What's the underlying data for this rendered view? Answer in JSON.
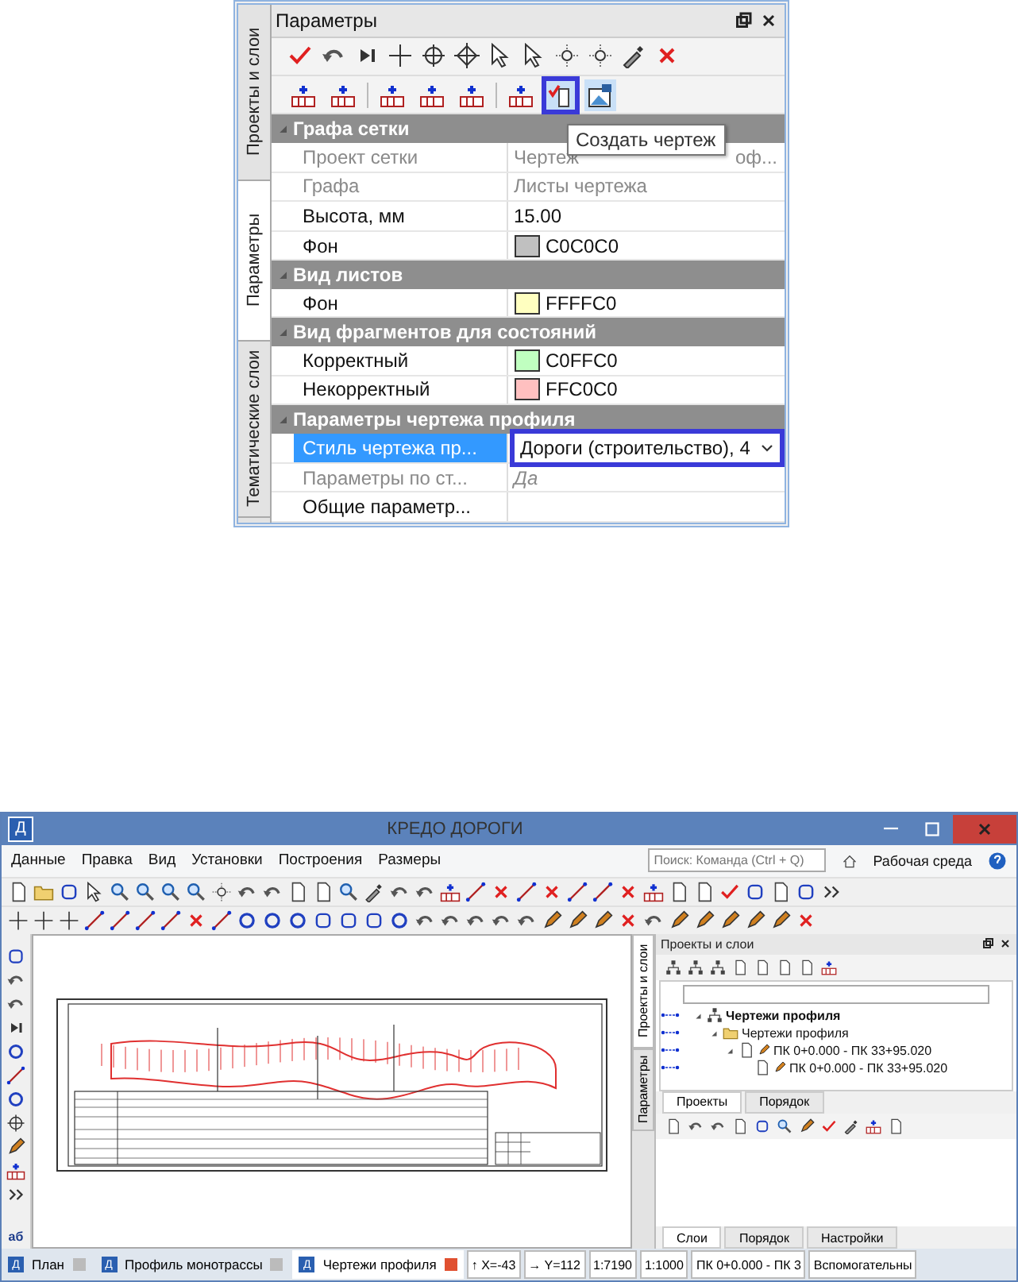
{
  "params_panel": {
    "side_tabs": [
      {
        "label": "Проекты и слои",
        "selected": false
      },
      {
        "label": "Параметры",
        "selected": true
      },
      {
        "label": "Тематические слои",
        "selected": false
      }
    ],
    "title": "Параметры",
    "toolbar_2": [
      {
        "pressed": false,
        "highlighted": false
      },
      {
        "pressed": false,
        "highlighted": false
      },
      {
        "pressed": false,
        "highlighted": false
      },
      {
        "pressed": false,
        "highlighted": false
      },
      {
        "pressed": false,
        "highlighted": false
      },
      {
        "pressed": false,
        "highlighted": false
      },
      {
        "pressed": true,
        "highlighted": true
      },
      {
        "pressed": true,
        "highlighted": false
      }
    ],
    "tooltip": "Создать чертеж",
    "groups": [
      {
        "title": "Графа сетки",
        "expanded": true,
        "rows": [
          {
            "label": "Проект сетки",
            "kind": "split",
            "value": "Чертеж",
            "value_tail": "оф...",
            "disabled": true,
            "selected": false
          },
          {
            "label": "Графа",
            "kind": "text",
            "value": "Листы чертежа",
            "disabled": true,
            "selected": false
          },
          {
            "label": "Высота, мм",
            "kind": "text",
            "value": "15.00",
            "disabled": false,
            "selected": false
          },
          {
            "label": "Фон",
            "kind": "color",
            "value": "C0C0C0",
            "color": "#c0c0c0",
            "disabled": false,
            "selected": false
          }
        ]
      },
      {
        "title": "Вид листов",
        "expanded": true,
        "rows": [
          {
            "label": "Фон",
            "kind": "color",
            "value": "FFFFC0",
            "color": "#ffffc0",
            "disabled": false,
            "selected": false
          }
        ]
      },
      {
        "title": "Вид фрагментов для состояний",
        "expanded": true,
        "rows": [
          {
            "label": "Корректный",
            "kind": "color",
            "value": "C0FFC0",
            "color": "#c0ffc0",
            "disabled": false,
            "selected": false
          },
          {
            "label": "Некорректный",
            "kind": "color",
            "value": "FFC0C0",
            "color": "#ffc0c0",
            "disabled": false,
            "selected": false
          }
        ]
      },
      {
        "title": "Параметры чертежа профиля",
        "expanded": true,
        "rows": [
          {
            "label": "Стиль чертежа пр...",
            "kind": "dropdown",
            "value": "Дороги (строительство), 4",
            "highlighted": true,
            "disabled": false,
            "selected": true
          },
          {
            "label": "Параметры по ст...",
            "kind": "text",
            "value": "Да",
            "italic": true,
            "disabled": true,
            "selected": false
          },
          {
            "label": "Общие параметр...",
            "kind": "text",
            "disabled": false,
            "selected": false
          }
        ]
      }
    ]
  },
  "app": {
    "title": "КРЕДО ДОРОГИ",
    "app_icon": "Д",
    "menu": [
      "Данные",
      "Правка",
      "Вид",
      "Установки",
      "Построения",
      "Размеры"
    ],
    "search": {
      "placeholder": "Поиск: Команда (Ctrl + Q)"
    },
    "workspace": "Рабочая среда",
    "text_tool_label": "аб",
    "side_panel": {
      "side_tabs": [
        {
          "label": "Проекты и слои",
          "selected": true
        },
        {
          "label": "Параметры",
          "selected": false
        }
      ],
      "title": "Проекты и слои",
      "tree": [
        {
          "label": "Чертежи профиля",
          "expanded": true,
          "bold": true,
          "children": [
            {
              "label": "Чертежи профиля",
              "expanded": true,
              "bold": false,
              "children": [
                {
                  "label": "ПК 0+0.000 - ПК 33+95.020",
                  "expanded": true,
                  "bold": false,
                  "children": [
                    {
                      "label": "ПК 0+0.000 - ПК 33+95.020",
                      "bold": false
                    }
                  ]
                }
              ]
            }
          ]
        }
      ],
      "mid_tabs": [
        {
          "label": "Проекты",
          "selected": true
        },
        {
          "label": "Порядок",
          "selected": false
        }
      ],
      "bottom_tabs": [
        {
          "label": "Слои",
          "selected": true
        },
        {
          "label": "Порядок",
          "selected": false
        },
        {
          "label": "Настройки",
          "selected": false
        }
      ]
    },
    "doc_tabs": [
      {
        "icon": "Д",
        "label": "План",
        "selected": false
      },
      {
        "icon": "Д",
        "label": "Профиль монотрассы",
        "selected": false
      },
      {
        "icon": "Д",
        "label": "Чертежи профиля",
        "selected": true
      }
    ],
    "status": [
      "↑ X=-43",
      "→ Y=112",
      "1:7190",
      "1:1000",
      "ПК 0+0.000 - ПК 3",
      "Вспомогательны"
    ]
  }
}
